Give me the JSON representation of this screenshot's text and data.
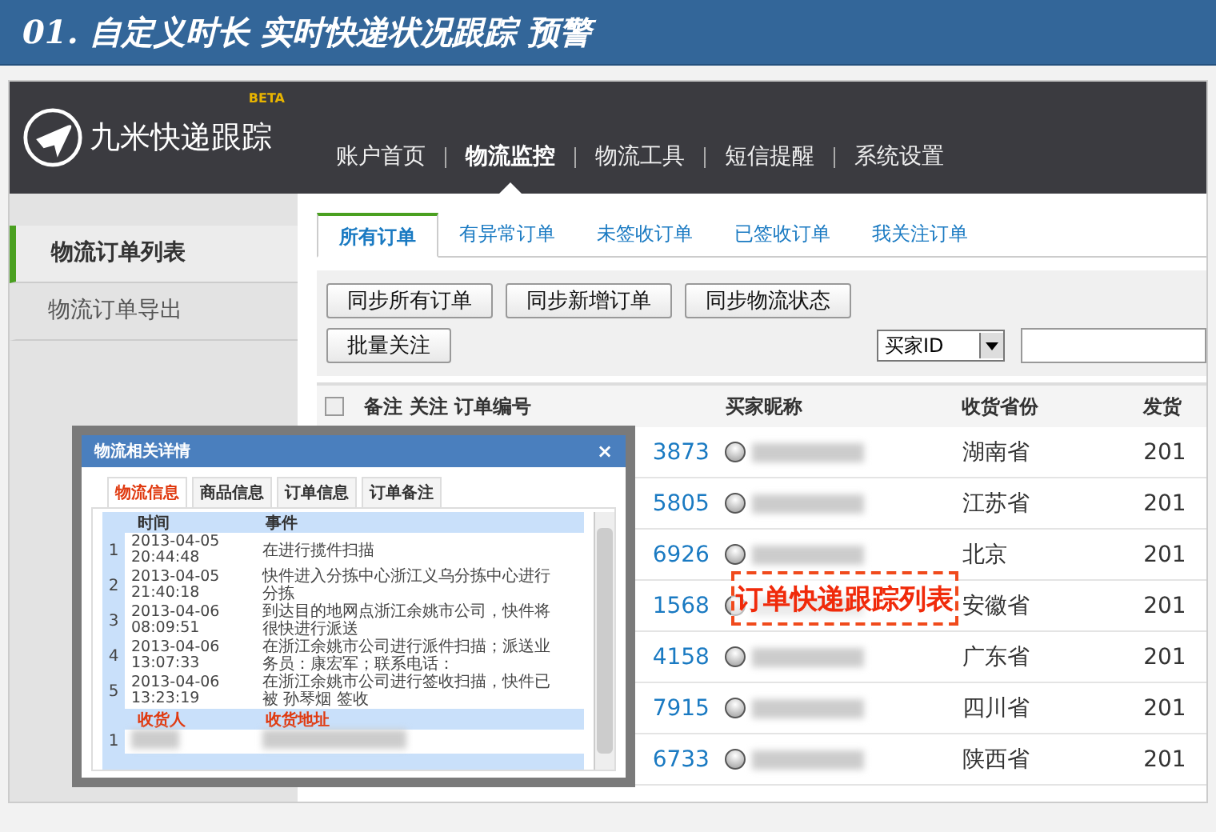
{
  "banner": {
    "title": "01. 自定义时长 实时快递状况跟踪 预警"
  },
  "logo": {
    "name": "九米快递跟踪",
    "badge": "BETA"
  },
  "nav": [
    {
      "label": "账户首页",
      "selected": false
    },
    {
      "label": "物流监控",
      "selected": true
    },
    {
      "label": "物流工具",
      "selected": false
    },
    {
      "label": "短信提醒",
      "selected": false
    },
    {
      "label": "系统设置",
      "selected": false
    }
  ],
  "sidebar": [
    {
      "label": "物流订单列表",
      "selected": true
    },
    {
      "label": "物流订单导出",
      "selected": false
    }
  ],
  "tabs": [
    {
      "label": "所有订单",
      "selected": true
    },
    {
      "label": "有异常订单",
      "selected": false
    },
    {
      "label": "未签收订单",
      "selected": false
    },
    {
      "label": "已签收订单",
      "selected": false
    },
    {
      "label": "我关注订单",
      "selected": false
    }
  ],
  "toolbar": {
    "buttons": [
      "同步所有订单",
      "同步新增订单",
      "同步物流状态",
      "批量关注"
    ],
    "filter": {
      "value": "买家ID"
    }
  },
  "table": {
    "select_all": {
      "checked": false
    },
    "columns": [
      "备注 关注 订单编号",
      "买家昵称",
      "收货省份",
      "发货"
    ],
    "rows": [
      {
        "order": "3873",
        "province": "湖南省",
        "column_4": "201"
      },
      {
        "order": "5805",
        "province": "江苏省",
        "column_4": "201"
      },
      {
        "order": "6926",
        "province": "北京",
        "column_4": "201"
      },
      {
        "order": "1568",
        "province": "安徽省",
        "column_4": "201"
      },
      {
        "order": "4158",
        "province": "广东省",
        "column_4": "201"
      },
      {
        "order": "7915",
        "province": "四川省",
        "column_4": "201"
      },
      {
        "order": "6733",
        "province": "陕西省",
        "column_4": "201"
      }
    ]
  },
  "popup": {
    "title": "物流相关详情",
    "close": "×",
    "tabs": [
      {
        "label": "物流信息",
        "selected": true
      },
      {
        "label": "商品信息",
        "selected": false
      },
      {
        "label": "订单信息",
        "selected": false
      },
      {
        "label": "订单备注",
        "selected": false
      }
    ],
    "columns": [
      "时间",
      "事件"
    ],
    "events": [
      {
        "index": "1",
        "time": "2013-04-05 20:44:48",
        "event": "在进行揽件扫描"
      },
      {
        "index": "2",
        "time": "2013-04-05 21:40:18",
        "event": "快件进入分拣中心浙江义乌分拣中心进行分拣"
      },
      {
        "index": "3",
        "time": "2013-04-06 08:09:51",
        "event": "到达目的地网点浙江余姚市公司，快件将很快进行派送"
      },
      {
        "index": "4",
        "time": "2013-04-06 13:07:33",
        "event": "在浙江余姚市公司进行派件扫描；派送业务员：康宏军；联系电话："
      },
      {
        "index": "5",
        "time": "2013-04-06 13:23:19",
        "event": "在浙江余姚市公司进行签收扫描，快件已被 孙琴烟 签收"
      }
    ],
    "receiver_columns": [
      "收货人",
      "收货地址"
    ],
    "receiver_rows": [
      {
        "index": "1"
      }
    ]
  },
  "annotation": "订单快递跟踪列表"
}
